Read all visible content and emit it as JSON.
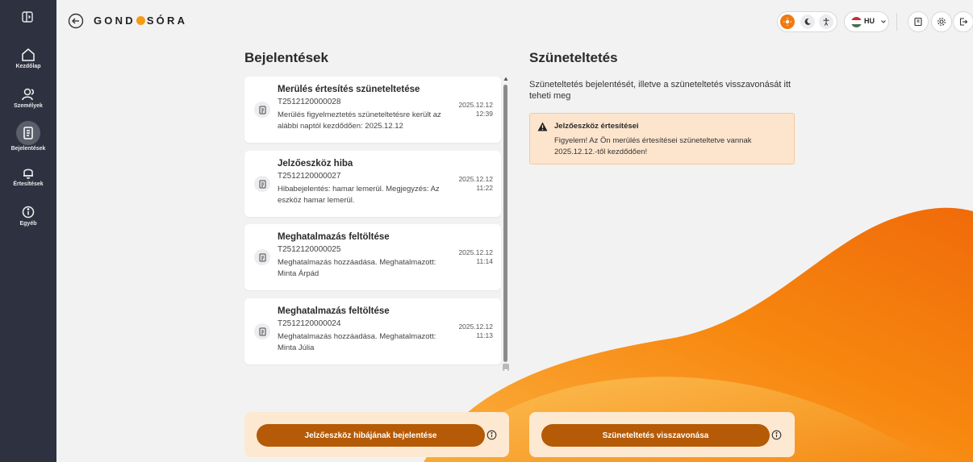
{
  "brand": {
    "before": "GOND",
    "after": "SÓRA"
  },
  "sidebar": {
    "items": [
      {
        "label": "Kezdőlap",
        "icon": "home-icon"
      },
      {
        "label": "Személyek",
        "icon": "people-icon"
      },
      {
        "label": "Bejelentések",
        "icon": "document-icon",
        "active": true
      },
      {
        "label": "Értesítések",
        "icon": "bell-icon"
      },
      {
        "label": "Egyéb",
        "icon": "info-icon"
      }
    ]
  },
  "header": {
    "language": "HU",
    "theme_active": "light",
    "accent": "#f07a10"
  },
  "left": {
    "title": "Bejelentések",
    "cards": [
      {
        "title": "Merülés értesítés szüneteltetése",
        "id": "T2512120000028",
        "desc": "Merülés figyelmeztetés szüneteltetésre került az alábbi naptól kezdődően: 2025.12.12",
        "date": "2025.12.12",
        "time": "12:39"
      },
      {
        "title": "Jelzőeszköz hiba",
        "id": "T2512120000027",
        "desc": "Hibabejelentés: hamar lemerül. Megjegyzés: Az eszköz hamar lemerül.",
        "date": "2025.12.12",
        "time": "11:22"
      },
      {
        "title": "Meghatalmazás feltöltése",
        "id": "T2512120000025",
        "desc": "Meghatalmazás hozzáadása. Meghatalmazott: Minta Árpád",
        "date": "2025.12.12",
        "time": "11:14"
      },
      {
        "title": "Meghatalmazás feltöltése",
        "id": "T2512120000024",
        "desc": "Meghatalmazás hozzáadása. Meghatalmazott: Minta Júlia",
        "date": "2025.12.12",
        "time": "11:13"
      }
    ],
    "action_label": "Jelzőeszköz hibájának bejelentése"
  },
  "right": {
    "title": "Szüneteltetés",
    "subtitle": "Szüneteltetés bejelentését, illetve a szüneteltetés visszavonását itt teheti meg",
    "alert_title": "Jelzőeszköz értesítései",
    "alert_text": "Figyelem! Az Ön merülés értesítései szüneteltetve vannak 2025.12.12.-től kezdődően!",
    "action_label": "Szüneteltetés visszavonása"
  },
  "colors": {
    "sidebar": "#2e3240",
    "button": "#b55a06",
    "alert_bg": "#fde5cd",
    "wave": "#f7780f"
  }
}
